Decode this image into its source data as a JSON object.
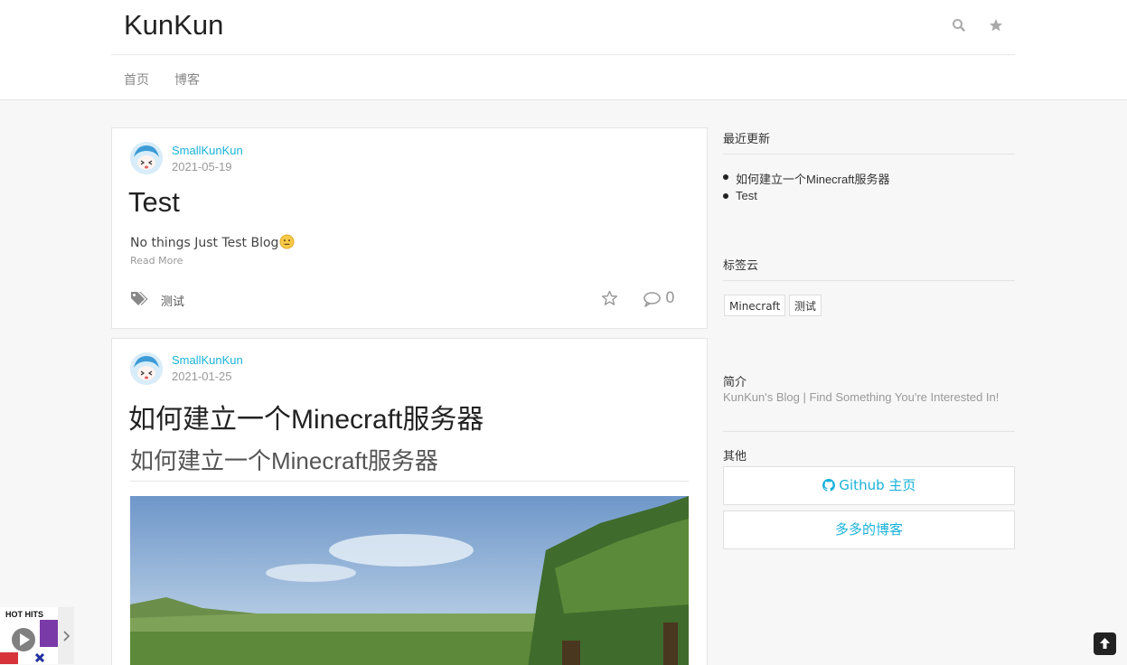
{
  "site": {
    "title": "KunKun"
  },
  "nav": {
    "items": [
      "首页",
      "博客"
    ]
  },
  "posts": [
    {
      "author": "SmallKunKun",
      "date": "2021-05-19",
      "title": "Test",
      "excerpt": "No things Just Test Blog",
      "read_more": "Read More",
      "tag": "测试",
      "comments": "0"
    },
    {
      "author": "SmallKunKun",
      "date": "2021-01-25",
      "title": "如何建立一个Minecraft服务器",
      "subtitle": "如何建立一个Minecraft服务器"
    }
  ],
  "sidebar": {
    "recent_title": "最近更新",
    "recent_items": [
      "如何建立一个Minecraft服务器",
      "Test"
    ],
    "tags_title": "标签云",
    "tags": [
      "Minecraft",
      "测试"
    ],
    "about_title": "简介",
    "about_text": "KunKun's Blog | Find Something You're Interested In!",
    "other_title": "其他",
    "buttons": [
      "Github 主页",
      "多多的博客"
    ]
  },
  "widget": {
    "label": "HOT HITS"
  },
  "icons": {
    "search": "search-icon",
    "star": "star-icon",
    "tags": "tags-icon",
    "comment": "comment-icon",
    "github": "github-icon",
    "up": "arrow-up-icon",
    "chevron": "chevron-right-icon"
  },
  "colors": {
    "accent": "#1ab2d8",
    "text": "#333333",
    "muted": "#999999"
  }
}
